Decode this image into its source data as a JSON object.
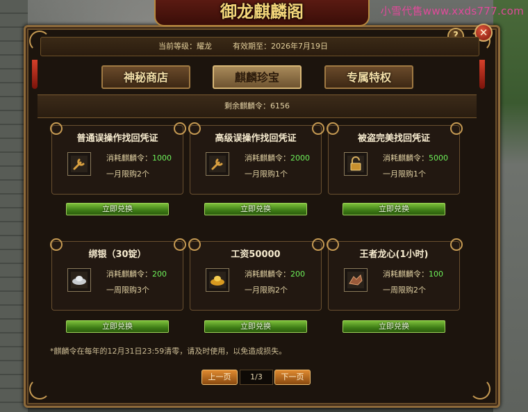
{
  "watermark": "小雪代售www.xxds777.com",
  "window_title": "御龙麒麟阁",
  "header": {
    "level_text": "当前等级：耀龙",
    "expire_text": "有效期至：2026年7月19日"
  },
  "buttons": {
    "help": "?",
    "close": "✕"
  },
  "tabs": [
    {
      "label": "神秘商店",
      "active": false
    },
    {
      "label": "麒麟珍宝",
      "active": true
    },
    {
      "label": "专属特权",
      "active": false
    }
  ],
  "remaining": "剩余麒麟令：6156",
  "cost_prefix": "消耗麒麟令：",
  "redeem_label": "立即兑换",
  "items": [
    {
      "title": "普通误操作找回凭证",
      "cost": "1000",
      "limit": "一月限购2个",
      "icon": "wrench-icon"
    },
    {
      "title": "高级误操作找回凭证",
      "cost": "2000",
      "limit": "一月限购1个",
      "icon": "wrench-icon"
    },
    {
      "title": "被盗完美找回凭证",
      "cost": "5000",
      "limit": "一月限购1个",
      "icon": "lock-icon"
    },
    {
      "title": "绑银（30锭）",
      "cost": "200",
      "limit": "一周限购3个",
      "icon": "silver-ingot-icon"
    },
    {
      "title": "工资50000",
      "cost": "200",
      "limit": "一月限购2个",
      "icon": "gold-ingot-icon"
    },
    {
      "title": "王者龙心(1小时)",
      "cost": "100",
      "limit": "一周限购2个",
      "icon": "dragon-heart-icon"
    }
  ],
  "footnote": "*麒麟令在每年的12月31日23:59清零，请及时使用，以免造成损失。",
  "pagination": {
    "prev": "上一页",
    "page": "1/3",
    "next": "下一页"
  },
  "colors": {
    "accent_green": "#6ef25a",
    "gold": "#c79b53",
    "panel": "#1c140d"
  }
}
